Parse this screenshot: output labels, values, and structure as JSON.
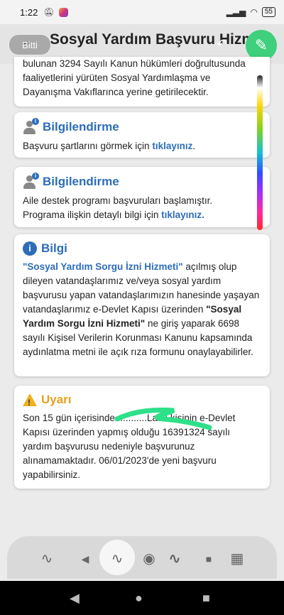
{
  "status": {
    "time": "1:22",
    "battery": "55"
  },
  "header": {
    "title": "Sosyal Yardım Başvuru Hizmeti",
    "done_label": "Bitti"
  },
  "intro_text": [
    "bulunan 3294 Sayılı Kanun hükümleri doğrultusunda",
    "faaliyetlerini yürüten Sosyal Yardımlaşma ve",
    "Dayanışma Vakıflarınca yerine getirilecektir."
  ],
  "card1": {
    "heading": "Bilgilendirme",
    "text": "Başvuru şartlarını görmek için ",
    "link": "tıklayınız",
    "after": "."
  },
  "card2": {
    "heading": "Bilgilendirme",
    "line1": "Aile destek programı başvuruları başlamıştır.",
    "line2": "Programa ilişkin detaylı bilgi için ",
    "link": "tıklayınız."
  },
  "card3": {
    "heading": "Bilgi",
    "link": "\"Sosyal Yardım Sorgu İzni Hizmeti\"",
    "text_after_link": " açılmış olup dileyen vatandaşlarımız ve/veya sosyal yardım başvurusu yapan vatandaşlarımızın hanesinde yaşayan vatandaşlarımız e-Devlet Kapısı üzerinden",
    "bold_quote": "\"Sosyal Yardım Sorgu İzni Hizmeti\"",
    "text_end": " ne giriş yaparak 6698 sayılı Kişisel Verilerin Korunması Kanunu kapsamında aydınlatma metni ile açık rıza formunu onaylayabilirler."
  },
  "card4": {
    "heading": "Uyarı",
    "text": "Son 15 gün içerisinde ...........Ladlı kişinin e-Devlet Kapısı üzerinden yapmış olduğu 16391324 sayılı yardım başvurusu nedeniyle başvurunuz alınamamaktadır. 06/01/2023'de yeni başvuru yapabilirsiniz."
  },
  "colors": {
    "accent": "#2d6db8",
    "warning": "#f0b020",
    "pencil": "#3ed07c"
  }
}
